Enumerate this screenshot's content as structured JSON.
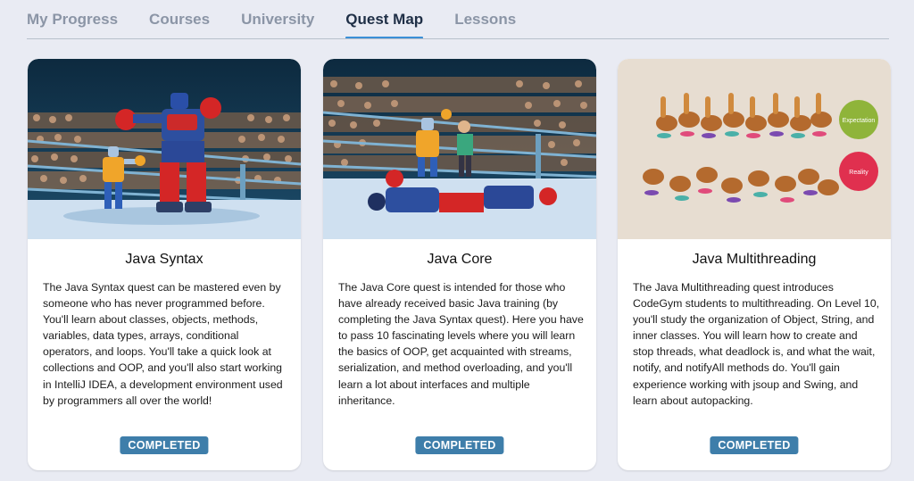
{
  "tabs": [
    {
      "label": "My Progress"
    },
    {
      "label": "Courses"
    },
    {
      "label": "University"
    },
    {
      "label": "Quest Map",
      "active": true
    },
    {
      "label": "Lessons"
    }
  ],
  "accent_color": "#3b8fd6",
  "badge_color": "#3e7eaa",
  "cards": [
    {
      "title": "Java Syntax",
      "description": "The Java Syntax quest can be mastered even by someone who has never programmed before. You'll learn about classes, objects, methods, variables, data types, arrays, conditional operators, and loops. You'll take a quick look at collections and OOP, and you'll also start working in IntelliJ IDEA, a development environment used by programmers all over the world!",
      "status": "COMPLETED",
      "image_icon": "robot-boxing-illustration"
    },
    {
      "title": "Java Core",
      "description": "The Java Core quest is intended for those who have already received basic Java training (by completing the Java Syntax quest). Here you have to pass 10 fascinating levels where you will learn the basics of OOP, get acquainted with streams, serialization, and method overloading, and you'll learn a lot about interfaces and multiple inheritance.",
      "status": "COMPLETED",
      "image_icon": "robot-knockout-illustration"
    },
    {
      "title": "Java Multithreading",
      "description": "The Java Multithreading quest introduces CodeGym students to multithreading. On Level 10, you'll study the organization of Object, String, and inner classes. You will learn how to create and stop threads, what deadlock is, and what the wait, notify, and notifyAll methods do. You'll gain experience working with jsoup and Swing, and learn about autopacking.",
      "status": "COMPLETED",
      "image_icon": "dogs-expectation-reality-illustration",
      "image_labels": {
        "top": "Expectation",
        "bottom": "Reality"
      }
    }
  ]
}
